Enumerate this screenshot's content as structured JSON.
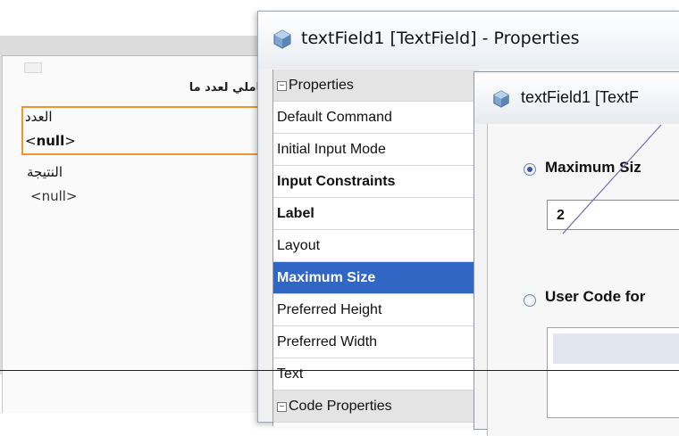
{
  "form": {
    "title": "فاملي لعدد ما",
    "field_label": "العدد",
    "field_value_open": "<",
    "field_value_bold": "null",
    "field_value_close": ">",
    "result_label": "النتيجة",
    "result_value": "<null>"
  },
  "dialog": {
    "title": "textField1 [TextField] - Properties",
    "properties": [
      {
        "label": "Properties",
        "type": "category"
      },
      {
        "label": "Default Command",
        "type": "normal"
      },
      {
        "label": "Initial Input Mode",
        "type": "normal"
      },
      {
        "label": "Input Constraints",
        "type": "bold"
      },
      {
        "label": "Label",
        "type": "bold"
      },
      {
        "label": "Layout",
        "type": "normal"
      },
      {
        "label": "Maximum Size",
        "type": "selected"
      },
      {
        "label": "Preferred Height",
        "type": "normal"
      },
      {
        "label": "Preferred Width",
        "type": "normal"
      },
      {
        "label": "Text",
        "type": "normal"
      },
      {
        "label": "Code Properties",
        "type": "category"
      }
    ]
  },
  "editor": {
    "title": "textField1 [TextF",
    "option_value_label": "Maximum Siz",
    "option_value_selected": true,
    "value": "2",
    "option_code_label": "User Code for",
    "option_code_selected": false
  }
}
